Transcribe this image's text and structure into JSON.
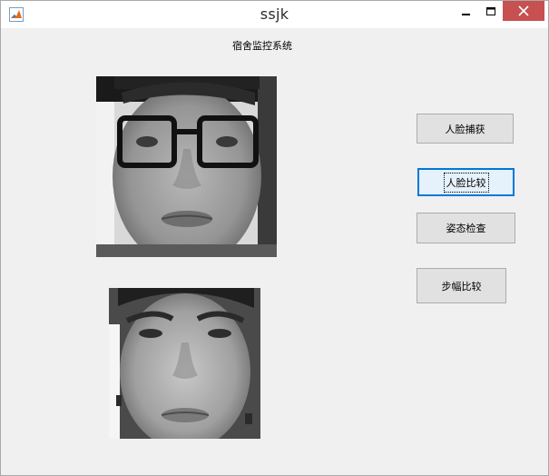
{
  "window": {
    "title": "ssjk"
  },
  "main": {
    "heading": "宿舍监控系统"
  },
  "buttons": {
    "face_capture": "人脸捕获",
    "face_compare": "人脸比较",
    "posture_check": "姿态检查",
    "stride_compare": "步幅比较"
  },
  "colors": {
    "close_button": "#c75050",
    "focused_button_border": "#0078d7",
    "focused_button_bg": "#e5f1fb"
  },
  "icons": {
    "app": "matlab-icon",
    "minimize": "minimize-icon",
    "maximize": "maximize-icon",
    "close": "close-icon"
  }
}
